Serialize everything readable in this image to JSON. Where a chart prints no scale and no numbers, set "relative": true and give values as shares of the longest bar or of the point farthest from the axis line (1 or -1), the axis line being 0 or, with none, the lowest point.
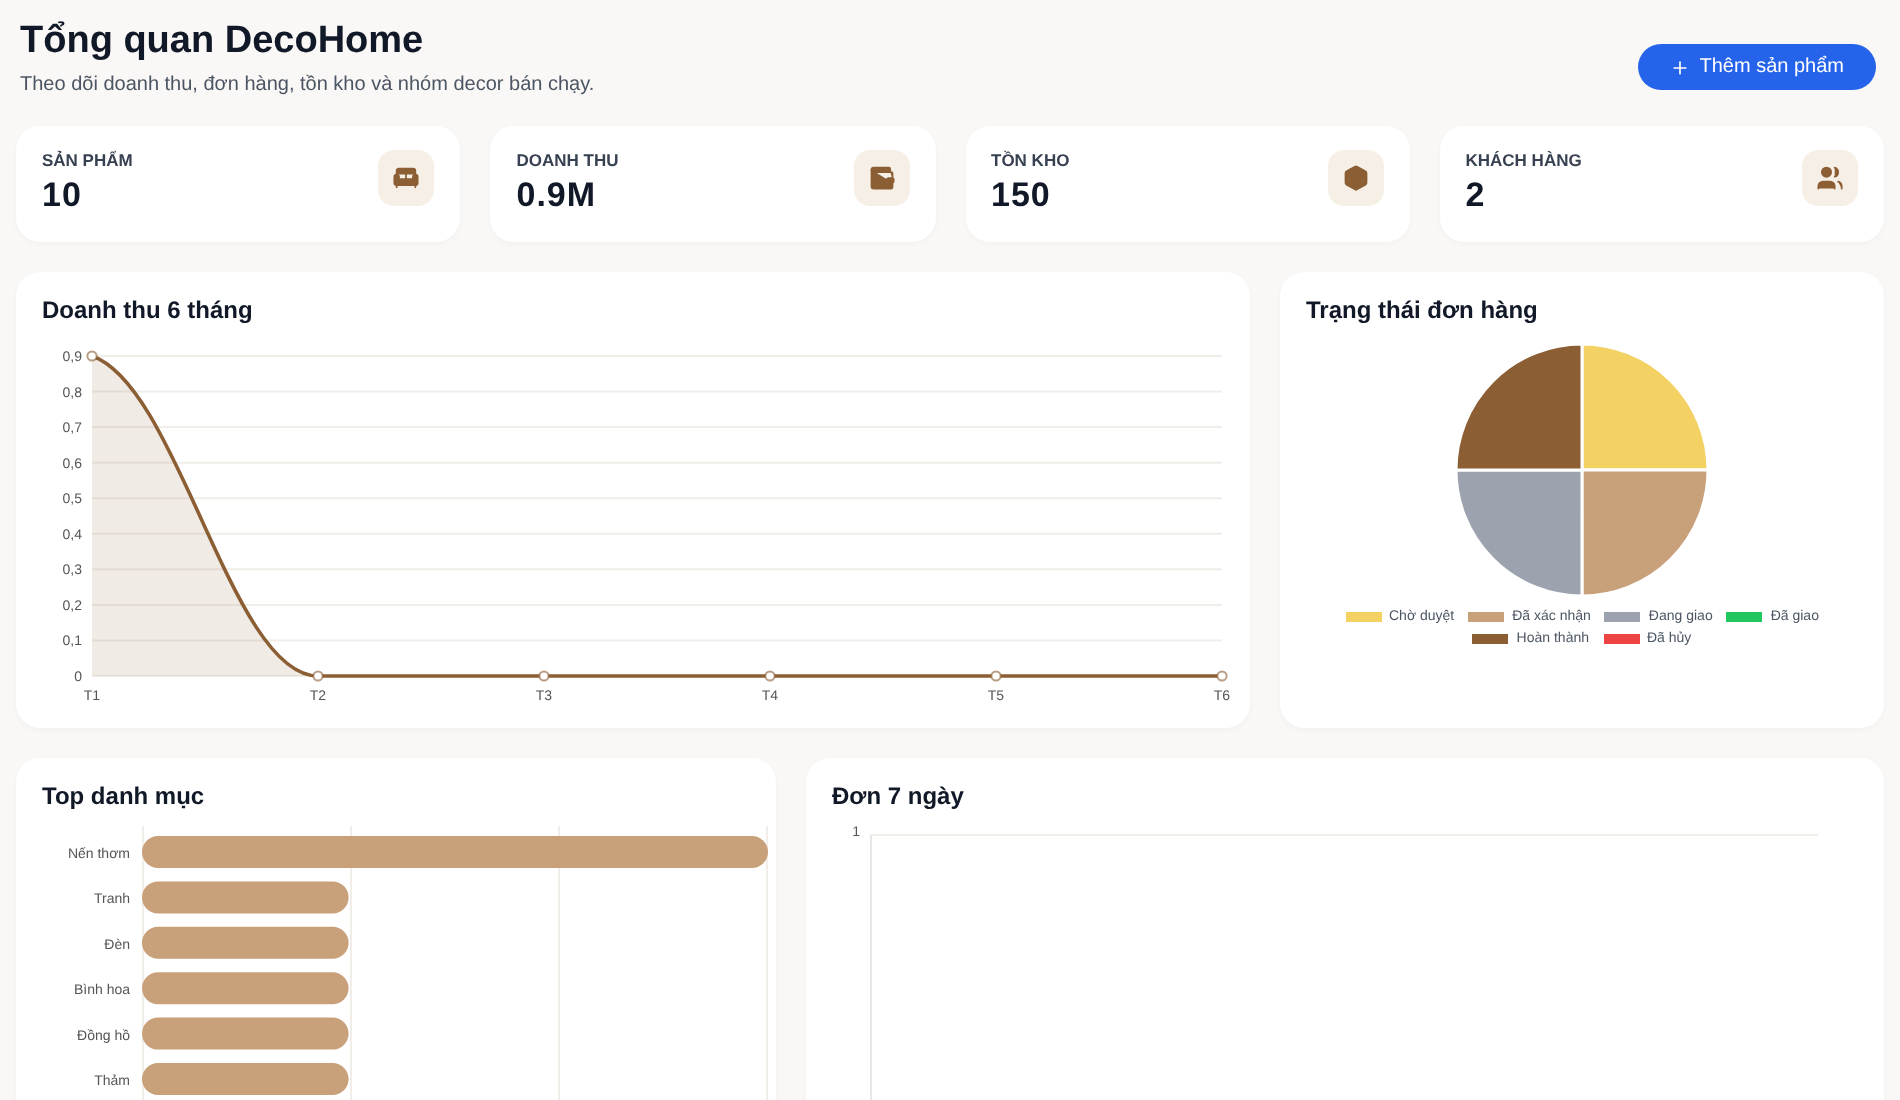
{
  "header": {
    "title": "Tổng quan DecoHome",
    "subtitle": "Theo dõi doanh thu, đơn hàng, tồn kho và nhóm decor bán chạy.",
    "action_button": "Thêm sản phẩm"
  },
  "stats": [
    {
      "label": "SẢN PHẨM",
      "value": "10",
      "kind": "sofa"
    },
    {
      "label": "DOANH THU",
      "value": "0.9M",
      "kind": "wallet"
    },
    {
      "label": "TỒN KHO",
      "value": "150",
      "kind": "box"
    },
    {
      "label": "KHÁCH HÀNG",
      "value": "2",
      "kind": "users"
    }
  ],
  "revenue_card": {
    "title": "Doanh thu 6 tháng",
    "chart_data": {
      "type": "area",
      "grid": true,
      "categories": [
        "T1",
        "T2",
        "T3",
        "T4",
        "T5",
        "T6"
      ],
      "series": [
        {
          "color": "#8b5e34",
          "values": [
            0.9,
            0,
            0,
            0,
            0,
            0
          ]
        }
      ],
      "ylim": [
        0,
        0.9
      ],
      "yticks": [
        {
          "value": 0,
          "label": "0"
        },
        {
          "value": 0.1,
          "label": "0,1"
        },
        {
          "value": 0.2,
          "label": "0,2"
        },
        {
          "value": 0.3,
          "label": "0,3"
        },
        {
          "value": 0.4,
          "label": "0,4"
        },
        {
          "value": 0.5,
          "label": "0,5"
        },
        {
          "value": 0.6,
          "label": "0,6"
        },
        {
          "value": 0.7,
          "label": "0,7"
        },
        {
          "value": 0.8,
          "label": "0,8"
        },
        {
          "value": 0.9,
          "label": "0,9"
        }
      ]
    }
  },
  "status_card": {
    "title": "Trạng thái đơn hàng",
    "chart_data": {
      "type": "pie",
      "categories": [
        "Chờ duyệt",
        "Đã xác nhận",
        "Đang giao",
        "Đã giao",
        "Hoàn thành",
        "Đã hủy"
      ],
      "series": [
        {
          "values": [
            25,
            25,
            25,
            0,
            25,
            0
          ]
        }
      ],
      "colors": [
        "#f3d163",
        "#c8a07a",
        "#9ca3af",
        "#22c55e",
        "#8b5e34",
        "#ef4444"
      ]
    }
  },
  "category_card": {
    "title": "Top danh mục",
    "chart_data": {
      "type": "bar",
      "orientation": "horizontal",
      "relative": true,
      "categories": [
        "Nến thơm",
        "Tranh",
        "Đèn",
        "Bình hoa",
        "Đồng hồ",
        "Thảm"
      ],
      "series": [
        {
          "color": "#c8a07a",
          "values": [
            1,
            0.33,
            0.33,
            0.33,
            0.33,
            0.33
          ]
        }
      ]
    }
  },
  "orders_card": {
    "title": "Đơn 7 ngày",
    "y_axis_label": "1"
  }
}
